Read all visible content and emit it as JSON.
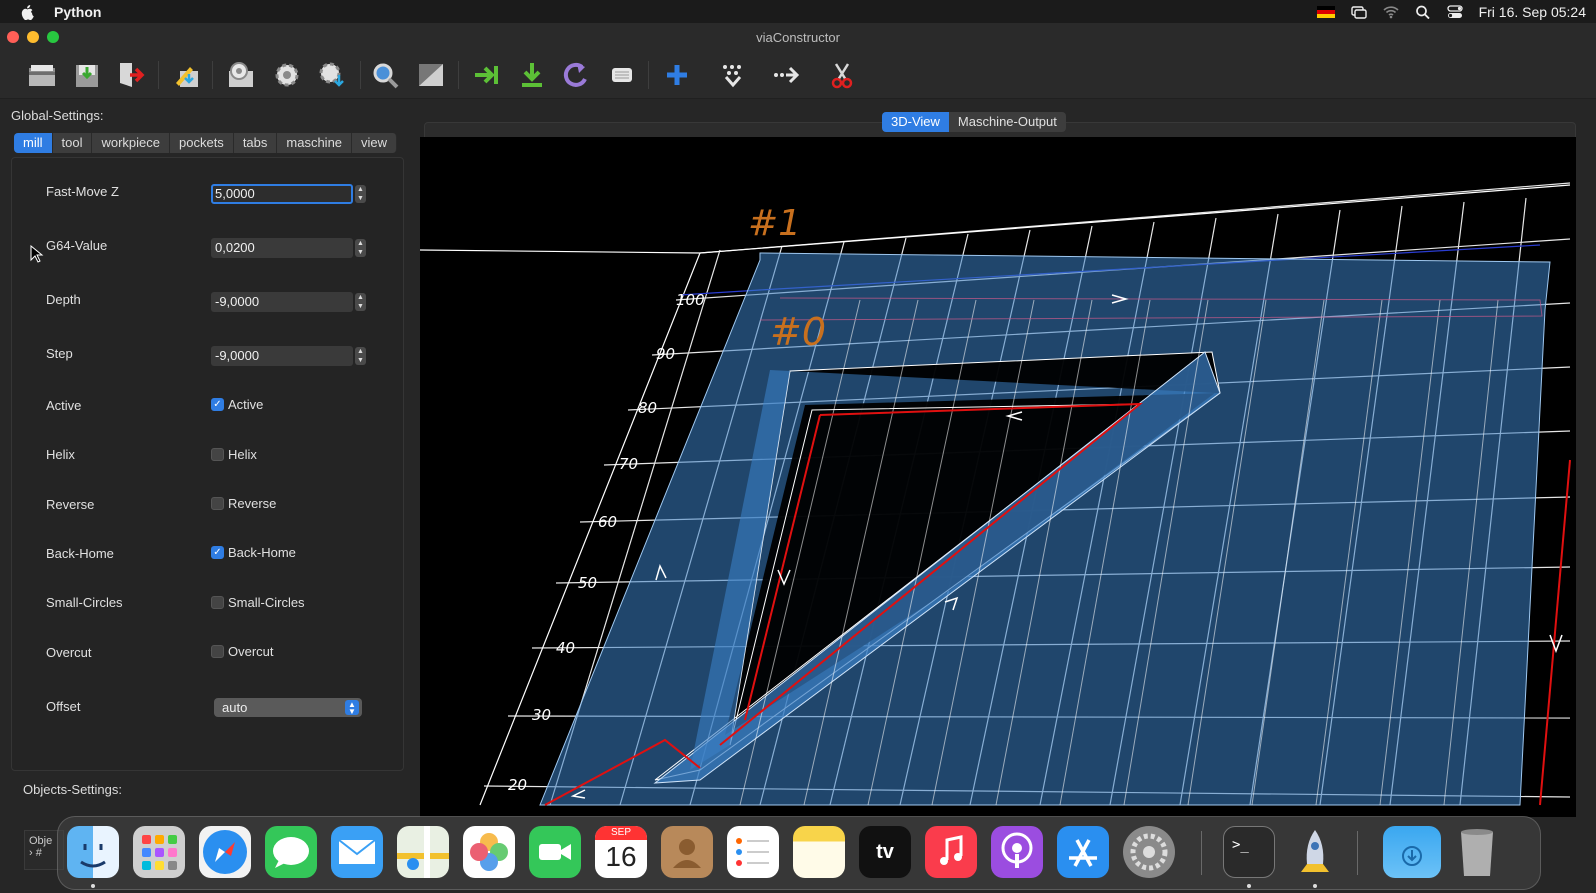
{
  "menubar": {
    "app_name": "Python",
    "clock": "Fri 16. Sep  05:24"
  },
  "window": {
    "title": "viaConstructor"
  },
  "toolbar": {
    "buttons": [
      "open-icon",
      "save-icon",
      "exit-icon",
      "edit-icon",
      "tool-settings-icon",
      "gear-icon",
      "gear-download-icon",
      "search-icon",
      "view-icon",
      "next-icon",
      "download-icon",
      "redo-icon",
      "grid-icon",
      "add-icon",
      "scatter-icon",
      "arrow-dots-icon",
      "scissors-icon"
    ]
  },
  "global_settings": {
    "label": "Global-Settings:",
    "tabs": [
      "mill",
      "tool",
      "workpiece",
      "pockets",
      "tabs",
      "maschine",
      "view"
    ],
    "active_tab": "mill",
    "fields": {
      "fast_move_z": {
        "label": "Fast-Move Z",
        "value": "5,0000"
      },
      "g64_value": {
        "label": "G64-Value",
        "value": "0,0200"
      },
      "depth": {
        "label": "Depth",
        "value": "-9,0000"
      },
      "step": {
        "label": "Step",
        "value": "-9,0000"
      }
    },
    "checks": {
      "active": {
        "label": "Active",
        "text": "Active",
        "checked": true
      },
      "helix": {
        "label": "Helix",
        "text": "Helix",
        "checked": false
      },
      "reverse": {
        "label": "Reverse",
        "text": "Reverse",
        "checked": false
      },
      "back_home": {
        "label": "Back-Home",
        "text": "Back-Home",
        "checked": true
      },
      "small_circles": {
        "label": "Small-Circles",
        "text": "Small-Circles",
        "checked": false
      },
      "overcut": {
        "label": "Overcut",
        "text": "Overcut",
        "checked": false
      }
    },
    "offset": {
      "label": "Offset",
      "value": "auto"
    }
  },
  "objects_settings": {
    "label": "Objects-Settings:",
    "tree_header": "Obje",
    "tree_item": "#"
  },
  "view_tabs": [
    "3D-View",
    "Maschine-Output"
  ],
  "active_view_tab": "3D-View",
  "scene": {
    "object_labels": [
      "#1",
      "#0"
    ],
    "grid_labels": [
      "100",
      "90",
      "80",
      "70",
      "60",
      "50",
      "40",
      "30",
      "20"
    ]
  },
  "dock": {
    "items": [
      "finder",
      "launchpad",
      "safari",
      "messages",
      "mail",
      "maps",
      "photos",
      "facetime",
      "calendar",
      "contacts",
      "reminders",
      "notes",
      "tv",
      "music",
      "podcasts",
      "app-store",
      "system-settings",
      "terminal",
      "python",
      "downloads",
      "trash"
    ],
    "calendar_month": "SEP",
    "calendar_day": "16",
    "tv_label": "tv"
  },
  "colors": {
    "accent": "#2f7de3",
    "path_red": "#e01010",
    "solid_blue": "#3b7fc4",
    "label_orange": "#c8701e"
  }
}
